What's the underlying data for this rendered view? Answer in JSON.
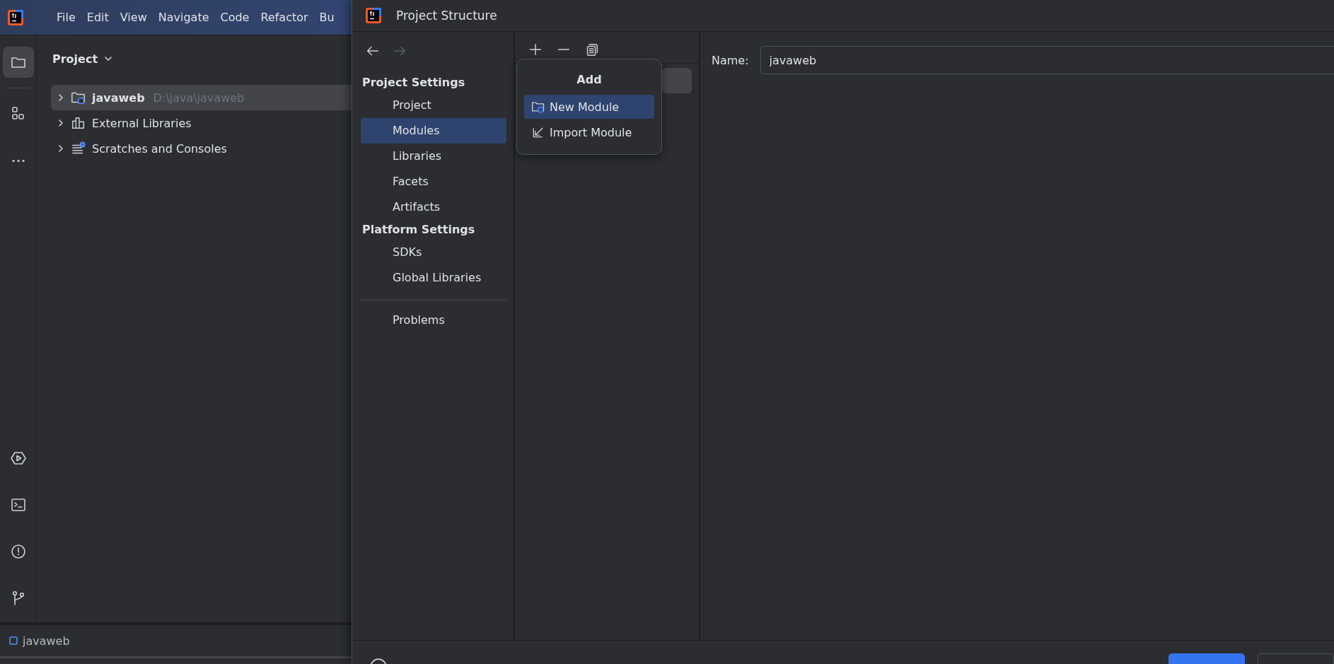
{
  "ide": {
    "menu": [
      {
        "label": "File"
      },
      {
        "label": "Edit"
      },
      {
        "label": "View"
      },
      {
        "label": "Navigate"
      },
      {
        "label": "Code"
      },
      {
        "label": "Refactor"
      },
      {
        "label": "Bu"
      }
    ],
    "toolbar_top": [
      {
        "kind": "folder",
        "selected": true
      },
      {
        "kind": "structure",
        "selected": false
      },
      {
        "kind": "more",
        "selected": false
      }
    ],
    "toolbar_bottom": [
      {
        "kind": "run",
        "selected": false
      },
      {
        "kind": "terminal",
        "selected": false
      },
      {
        "kind": "problems",
        "selected": false
      },
      {
        "kind": "git",
        "selected": false
      }
    ],
    "project_panel": {
      "title": "Project",
      "tree": [
        {
          "label": "javaweb",
          "path": "D:\\java\\javaweb",
          "kind": "module",
          "selected": true,
          "expanded": false
        },
        {
          "label": "External Libraries",
          "kind": "libraries",
          "selected": false,
          "expanded": false
        },
        {
          "label": "Scratches and Consoles",
          "kind": "scratches",
          "selected": false,
          "expanded": false
        }
      ]
    },
    "status_bar": {
      "crumb": "javaweb"
    }
  },
  "dialog": {
    "title": "Project Structure",
    "nav_arrows": [
      {
        "kind": "back",
        "disabled": false
      },
      {
        "kind": "forward",
        "disabled": true
      }
    ],
    "nav": [
      {
        "header": "Project Settings",
        "items": [
          {
            "label": "Project",
            "selected": false
          },
          {
            "label": "Modules",
            "selected": true
          },
          {
            "label": "Libraries",
            "selected": false
          },
          {
            "label": "Facets",
            "selected": false
          },
          {
            "label": "Artifacts",
            "selected": false
          }
        ]
      },
      {
        "header": "Platform Settings",
        "items": [
          {
            "label": "SDKs",
            "selected": false
          },
          {
            "label": "Global Libraries",
            "selected": false
          }
        ]
      }
    ],
    "nav_bottom": [
      {
        "label": "Problems",
        "selected": false
      }
    ],
    "list_toolbar": [
      {
        "kind": "add"
      },
      {
        "kind": "remove"
      },
      {
        "kind": "copy"
      }
    ],
    "add_popup": {
      "title": "Add",
      "items": [
        {
          "label": "New Module",
          "kind": "new",
          "selected": true
        },
        {
          "label": "Import Module",
          "kind": "import",
          "selected": false
        }
      ]
    },
    "name_field": {
      "label": "Name:",
      "value": "javaweb"
    }
  }
}
